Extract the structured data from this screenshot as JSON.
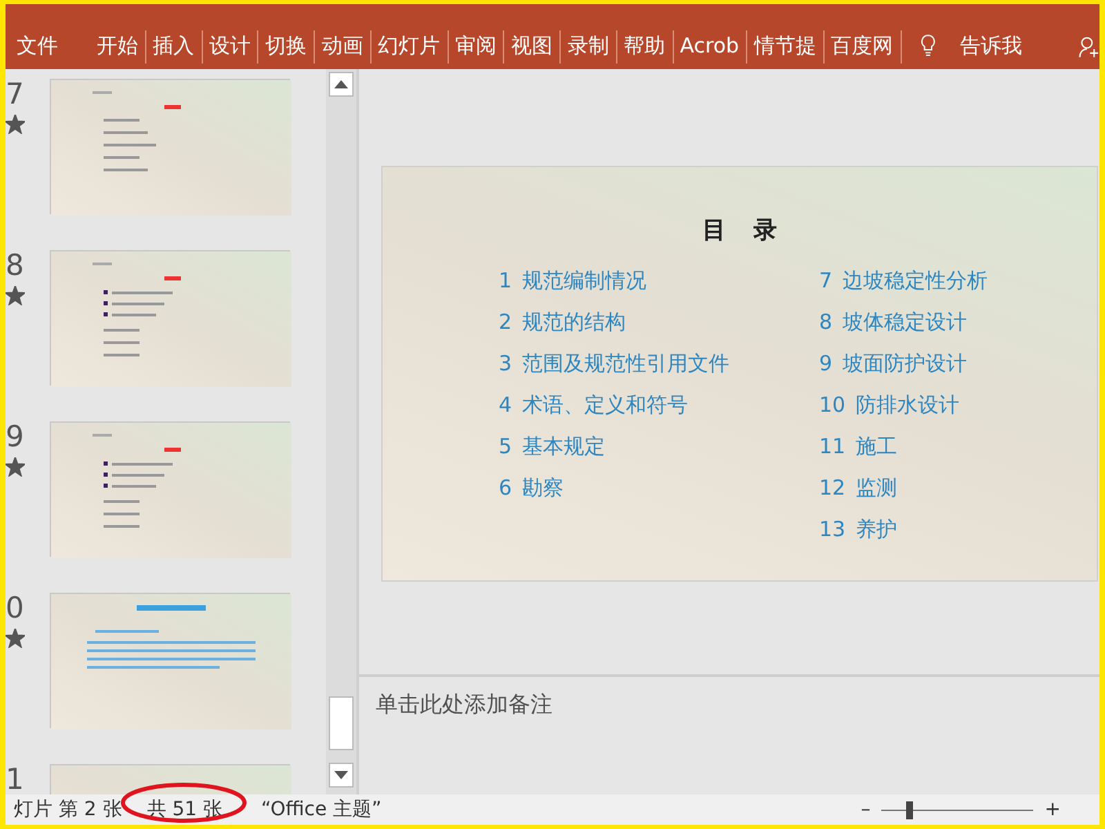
{
  "ribbon": {
    "tabs": [
      {
        "label": "文件"
      },
      {
        "label": "开始"
      },
      {
        "label": "插入"
      },
      {
        "label": "设计"
      },
      {
        "label": "切换"
      },
      {
        "label": "动画"
      },
      {
        "label": "幻灯片"
      },
      {
        "label": "审阅"
      },
      {
        "label": "视图"
      },
      {
        "label": "录制"
      },
      {
        "label": "帮助"
      },
      {
        "label": "Acrob"
      },
      {
        "label": "情节提"
      },
      {
        "label": "百度网"
      }
    ],
    "tell_me": "告诉我"
  },
  "thumbnails": [
    {
      "number": "7",
      "starred": true,
      "kind": "outline"
    },
    {
      "number": "8",
      "starred": true,
      "kind": "bullets"
    },
    {
      "number": "9",
      "starred": true,
      "kind": "bullets"
    },
    {
      "number": "0",
      "starred": true,
      "kind": "text"
    },
    {
      "number": "1",
      "kind": "blank"
    }
  ],
  "slide": {
    "title": "目 录",
    "left_items": [
      {
        "number": "1",
        "text": "规范编制情况"
      },
      {
        "number": "2",
        "text": "规范的结构"
      },
      {
        "number": "3",
        "text": "范围及规范性引用文件"
      },
      {
        "number": "4",
        "text": "术语、定义和符号"
      },
      {
        "number": "5",
        "text": "基本规定"
      },
      {
        "number": "6",
        "text": "勘察"
      }
    ],
    "right_items": [
      {
        "number": "7",
        "text": "边坡稳定性分析"
      },
      {
        "number": "8",
        "text": "坡体稳定设计"
      },
      {
        "number": "9",
        "text": "坡面防护设计"
      },
      {
        "number": "10",
        "text": "防排水设计"
      },
      {
        "number": "11",
        "text": "施工"
      },
      {
        "number": "12",
        "text": "监测"
      },
      {
        "number": "13",
        "text": "养护"
      }
    ]
  },
  "notes": {
    "placeholder": "单击此处添加备注"
  },
  "status_bar": {
    "slide_position": "灯片 第 2 张",
    "slide_count": "共 51 张",
    "theme": "“Office 主题”",
    "zoom_minus": "–",
    "zoom_plus": "+",
    "zoom": {
      "level": 0.17
    }
  }
}
